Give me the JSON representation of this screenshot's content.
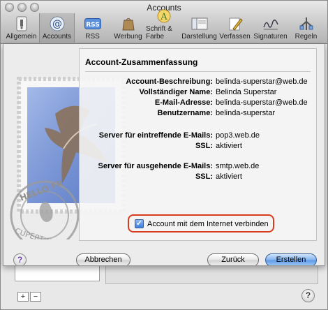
{
  "window": {
    "title": "Accounts"
  },
  "toolbar": {
    "items": [
      {
        "label": "Allgemein",
        "icon": "general-switch-icon"
      },
      {
        "label": "Accounts",
        "icon": "at-sign-icon",
        "selected": true
      },
      {
        "label": "RSS",
        "icon": "rss-icon"
      },
      {
        "label": "Werbung",
        "icon": "junk-bag-icon"
      },
      {
        "label": "Schrift & Farbe",
        "icon": "font-color-icon"
      },
      {
        "label": "Darstellung",
        "icon": "display-icon"
      },
      {
        "label": "Verfassen",
        "icon": "compose-pencil-icon"
      },
      {
        "label": "Signaturen",
        "icon": "signature-icon"
      },
      {
        "label": "Regeln",
        "icon": "rules-icon"
      }
    ]
  },
  "sheet": {
    "title": "Account-Zusammenfassung",
    "rows": [
      {
        "key": "Account-Beschreibung:",
        "value": "belinda-superstar@web.de"
      },
      {
        "key": "Vollständiger Name:",
        "value": "Belinda Superstar"
      },
      {
        "key": "E-Mail-Adresse:",
        "value": "belinda-superstar@web.de"
      },
      {
        "key": "Benutzername:",
        "value": "belinda-superstar"
      },
      {
        "key": "Server für eintreffende E-Mails:",
        "value": "pop3.web.de"
      },
      {
        "key": "SSL:",
        "value": "aktiviert"
      },
      {
        "key": "Server für ausgehende E-Mails:",
        "value": "smtp.web.de"
      },
      {
        "key": "SSL:",
        "value": "aktiviert"
      }
    ],
    "checkbox": {
      "label": "Account mit dem Internet verbinden",
      "checked": true
    },
    "buttons": {
      "help": "?",
      "cancel": "Abbrechen",
      "back": "Zurück",
      "create": "Erstellen"
    },
    "stamp_text": {
      "top": "HELLO FR",
      "bottom": "CUPERTINO CA"
    }
  },
  "background": {
    "add": "+",
    "remove": "−",
    "help": "?"
  },
  "colors": {
    "highlight_frame": "#d73b1d",
    "default_button": "#5d99e6"
  }
}
